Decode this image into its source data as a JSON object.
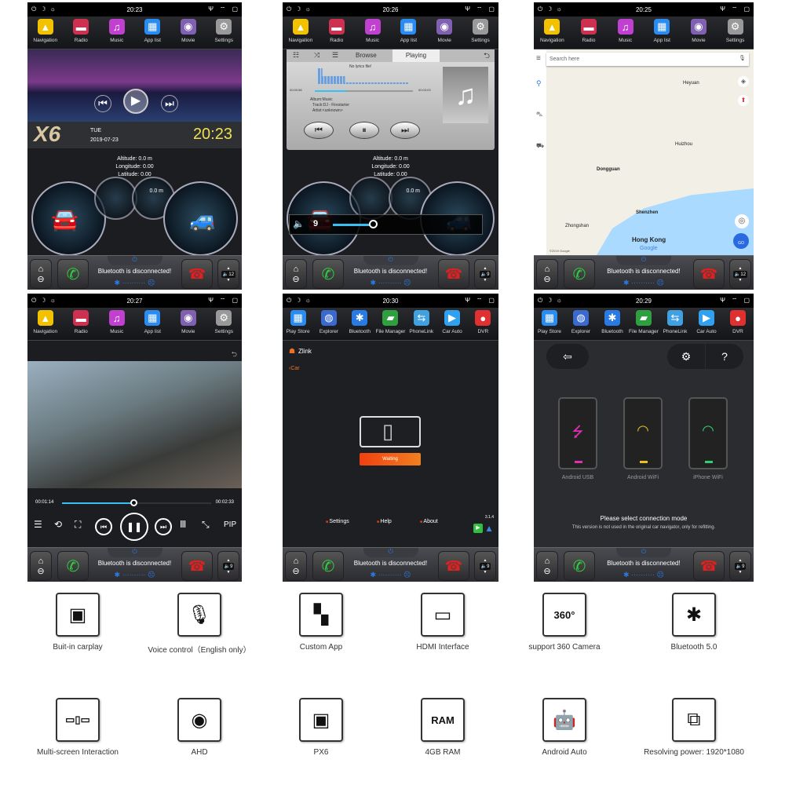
{
  "common": {
    "bluetooth_status": "Bluetooth is disconnected!",
    "bt_line": "✱ ·········· ☹",
    "home_icon": "home-icon",
    "back_icon": "back-icon"
  },
  "apps_a": [
    {
      "label": "Navigation",
      "icon": "▲",
      "color": "#f2c200"
    },
    {
      "label": "Radio",
      "icon": "▬",
      "color": "#d03050"
    },
    {
      "label": "Music",
      "icon": "♫",
      "color": "#c040d0"
    },
    {
      "label": "App list",
      "icon": "▦",
      "color": "#2a8cf0"
    },
    {
      "label": "Movie",
      "icon": "◉",
      "color": "#8060b0"
    },
    {
      "label": "Settings",
      "icon": "⚙",
      "color": "#999"
    }
  ],
  "apps_b": [
    {
      "label": "Play Store",
      "icon": "▦",
      "color": "#2a8cf0"
    },
    {
      "label": "Explorer",
      "icon": "◍",
      "color": "#3a6ad0"
    },
    {
      "label": "Bluetooth",
      "icon": "✱",
      "color": "#2a7ae4"
    },
    {
      "label": "File Manager",
      "icon": "▰",
      "color": "#2ea040"
    },
    {
      "label": "PhoneLink",
      "icon": "⇆",
      "color": "#40a0e0"
    },
    {
      "label": "Car Auto",
      "icon": "▶",
      "color": "#30a0f0"
    },
    {
      "label": "DVR",
      "icon": "●",
      "color": "#e03030"
    }
  ],
  "panels": [
    {
      "time": "20:23",
      "volume": "12",
      "home": {
        "day": "TUE",
        "date": "2019-07-23",
        "clock": "20:23",
        "logo": "X6"
      },
      "gps": {
        "altitude": "Altitude:  0.0 m",
        "longitude": "Longitude:  0.00",
        "latitude": "Latitude:  0.00",
        "alt_gauge": "0.0 m"
      }
    },
    {
      "time": "20:26",
      "volume": "9",
      "music": {
        "tab_browse": "Browse",
        "tab_playing": "Playing",
        "lyrics": "No lyrics file!",
        "elapsed": "00:00:58",
        "total": "00:03:03",
        "progress": 0.32,
        "album": "Album:Music",
        "track": "Track:DJ - Firestarter",
        "artist": "Artist:<unknown>"
      },
      "gps": {
        "altitude": "Altitude:  0.0 m",
        "longitude": "Longitude:  0.00",
        "latitude": "Latitude:  0.00",
        "alt_gauge": "0.0 m"
      },
      "volume_overlay": {
        "level": "9",
        "fraction": 0.6
      }
    },
    {
      "time": "20:25",
      "volume": "12",
      "map": {
        "search_placeholder": "Search here",
        "labels": [
          "Heyuan",
          "Huizhou",
          "Dongguan",
          "Shenzhen",
          "Hong Kong",
          "Zhongshan"
        ],
        "logo": "Google",
        "copyright": "©2019 Google",
        "go": "GO"
      }
    },
    {
      "time": "20:27",
      "volume": "9",
      "video": {
        "elapsed": "00:01:14",
        "total": "00:02:33",
        "progress": 0.48,
        "pip": "PIP"
      }
    },
    {
      "time": "20:30",
      "volume": "9",
      "zlink": {
        "brand": "Zlink",
        "back": "Car",
        "waiting": "Waiting",
        "settings": "Settings",
        "help": "Help",
        "about": "About",
        "version": "3.1.4"
      }
    },
    {
      "time": "20:29",
      "volume": "9",
      "connect": {
        "modes": [
          {
            "label": "Android USB",
            "icon": "⭍",
            "color": "#e030b0"
          },
          {
            "label": "Android WiFi",
            "icon": "◠",
            "color": "#e8c020"
          },
          {
            "label": "iPhone WiFi",
            "icon": "◠",
            "color": "#30d070"
          }
        ],
        "title": "Please select connection mode",
        "note": "This version is not used in the original car navigator, only for refitting."
      }
    }
  ],
  "features": [
    {
      "label": "Buit-in carplay",
      "icon": "carplay-icon",
      "glyph": "▣"
    },
    {
      "label": "Voice control（English only）",
      "icon": "microphone-icon",
      "glyph": "🎙"
    },
    {
      "label": "Custom App",
      "icon": "app-grid-icon",
      "glyph": "▚"
    },
    {
      "label": "HDMI Interface",
      "icon": "hdmi-icon",
      "glyph": "▭"
    },
    {
      "label": "support 360 Camera",
      "icon": "camera-360-icon",
      "glyph": "360°"
    },
    {
      "label": "Bluetooth 5.0",
      "icon": "bluetooth-icon",
      "glyph": "✱"
    },
    {
      "label": "Multi-screen Interaction",
      "icon": "multi-screen-icon",
      "glyph": "▭▯▭"
    },
    {
      "label": "AHD",
      "icon": "webcam-icon",
      "glyph": "◉"
    },
    {
      "label": "PX6",
      "icon": "chip-icon",
      "glyph": "▣"
    },
    {
      "label": "4GB  RAM",
      "icon": "ram-icon",
      "glyph": "RAM"
    },
    {
      "label": "Android Auto",
      "icon": "android-icon",
      "glyph": "🤖"
    },
    {
      "label": "Resolving power: 1920*1080",
      "icon": "resolution-icon",
      "glyph": "⧉"
    }
  ]
}
